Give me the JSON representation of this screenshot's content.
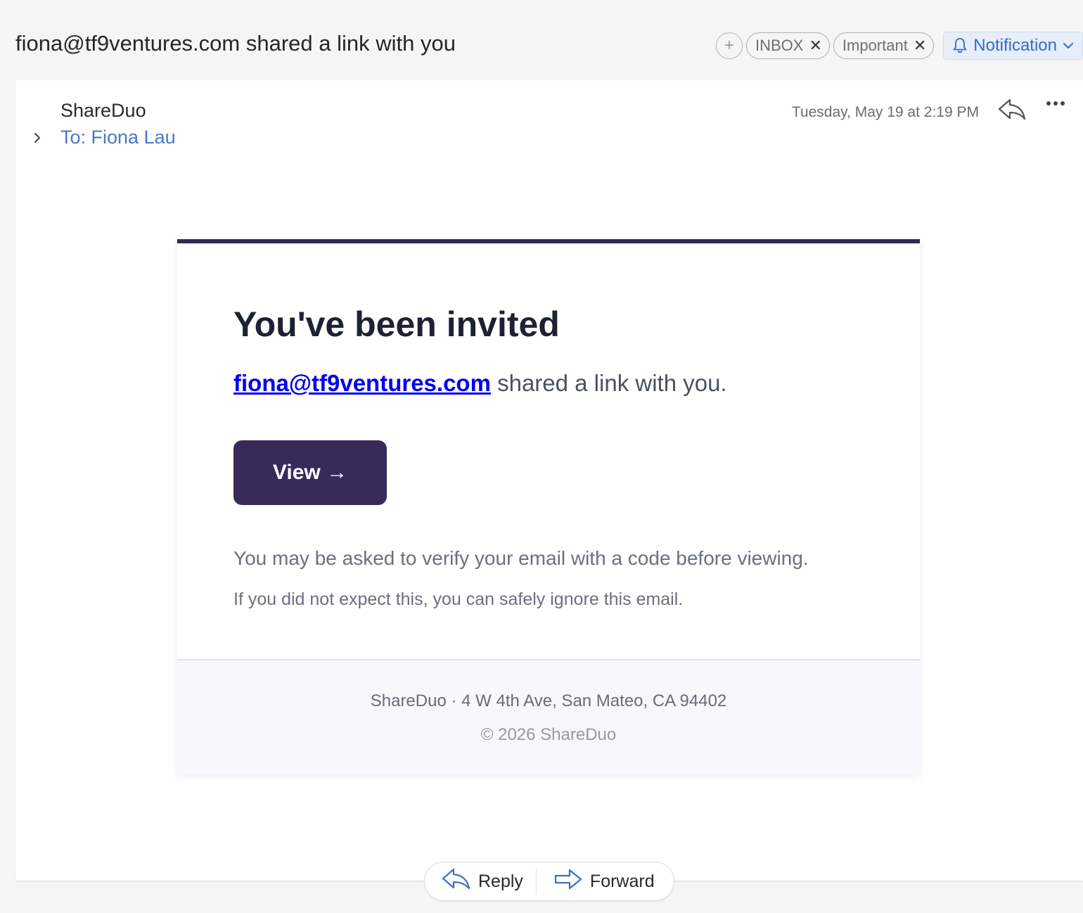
{
  "header": {
    "subject": "fiona@tf9ventures.com shared a link with you",
    "labels": [
      {
        "name": "INBOX",
        "remove": "✕"
      },
      {
        "name": "Important",
        "remove": "✕"
      }
    ],
    "add_label_glyph": "+",
    "notification_label": "Notification"
  },
  "message": {
    "sender": "ShareDuo",
    "to": "To: Fiona Lau",
    "date": "Tuesday, May 19 at 2:19 PM"
  },
  "email": {
    "title": "You've been invited",
    "link_email": "fiona@tf9ventures.com",
    "link_suffix": " shared a link with you.",
    "button_label": "View →",
    "note_verify": "You may be asked to verify your email with a code before viewing.",
    "note_ignore": "If you did not expect this, you can safely ignore this email.",
    "footer_address": "ShareDuo · 4 W 4th Ave, San Mateo, CA 94402",
    "footer_copyright": "© 2026 ShareDuo"
  },
  "actions": {
    "reply": "Reply",
    "forward": "Forward"
  },
  "colors": {
    "accent_blue": "#2f6ccb",
    "brand_purple": "#372b5a",
    "link_blue": "#0000ee"
  },
  "icons": [
    "chevron-right-icon",
    "reply-icon",
    "more-icon",
    "bell-icon",
    "chevron-down-icon",
    "forward-icon"
  ]
}
